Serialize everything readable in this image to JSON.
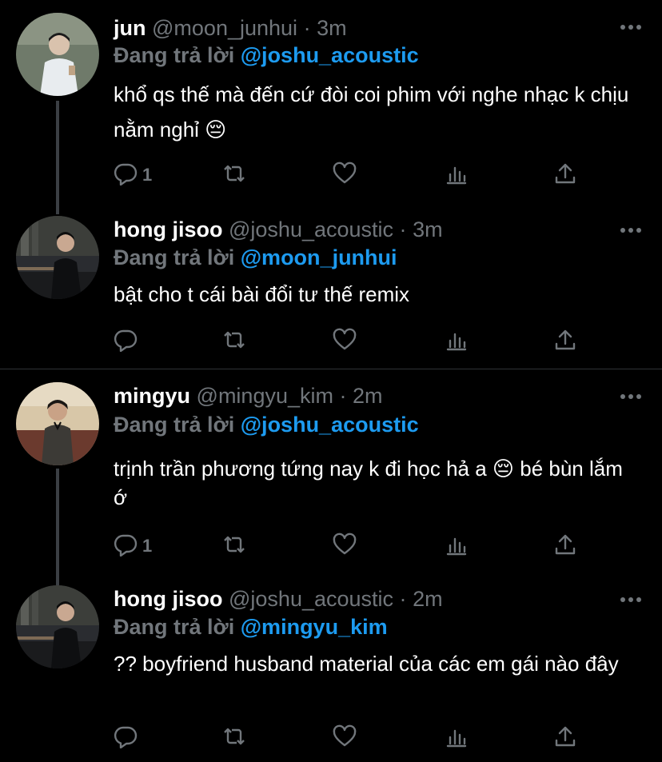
{
  "reply_prefix": "Đang trả lời",
  "tweets": [
    {
      "name": "jun",
      "handle": "@moon_junhui",
      "separator": "·",
      "time": "3m",
      "reply_to": "@joshu_acoustic",
      "text": "khổ qs thế mà đến cứ đòi coi phim với nghe nhạc k chịu nằm nghỉ 😔",
      "reply_count": "1",
      "avatar_colors": {
        "bg": "#6f7a6a",
        "accent": "#c9cec8"
      }
    },
    {
      "name": "hong jisoo",
      "handle": "@joshu_acoustic",
      "separator": "·",
      "time": "3m",
      "reply_to": "@moon_junhui",
      "text": "bật cho t cái bài đổi tư thế remix",
      "reply_count": "",
      "avatar_colors": {
        "bg": "#2a2c30",
        "accent": "#101214"
      }
    },
    {
      "name": "mingyu",
      "handle": "@mingyu_kim",
      "separator": "·",
      "time": "2m",
      "reply_to": "@joshu_acoustic",
      "text": "trịnh trần phương tứng nay k đi học hả a 😔  bé bùn lắm ớ",
      "reply_count": "1",
      "avatar_colors": {
        "bg": "#d8c7a8",
        "accent": "#3c3a36"
      }
    },
    {
      "name": "hong jisoo",
      "handle": "@joshu_acoustic",
      "separator": "·",
      "time": "2m",
      "reply_to": "@mingyu_kim",
      "text": "?? boyfriend husband material của các em gái nào đây",
      "reply_count": "",
      "avatar_colors": {
        "bg": "#2a2c30",
        "accent": "#101214"
      }
    }
  ],
  "icons": {
    "reply": "comment-icon",
    "retweet": "retweet-icon",
    "like": "heart-icon",
    "analytics": "analytics-icon",
    "share": "share-icon",
    "more": "more-icon"
  },
  "colors": {
    "background": "#000000",
    "muted": "#71767b",
    "link": "#1d9bf0",
    "thread_line": "#3b3f44",
    "divider": "#2f3336"
  }
}
